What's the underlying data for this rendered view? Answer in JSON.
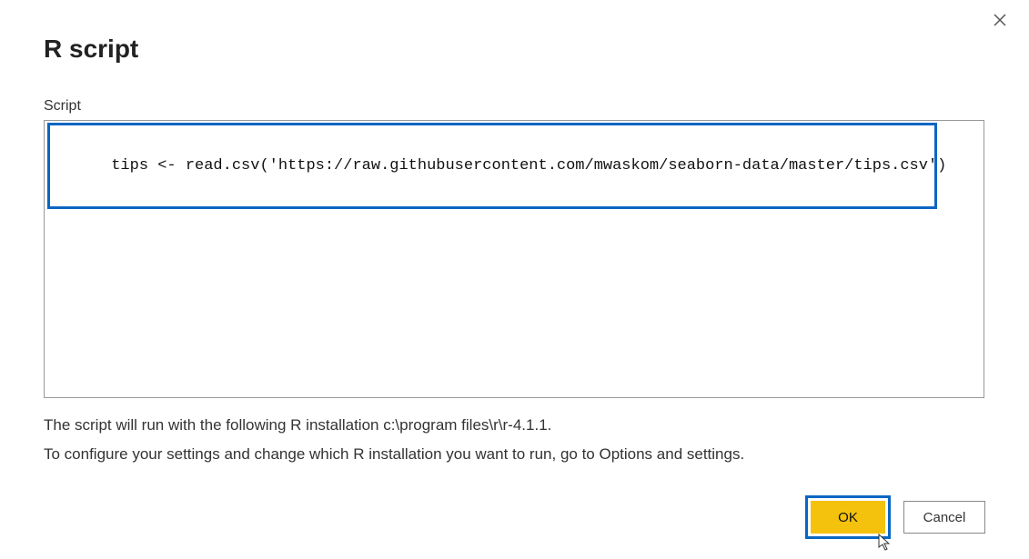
{
  "dialog": {
    "title": "R script",
    "close_icon": "close-icon"
  },
  "script": {
    "label": "Script",
    "content": "tips <- read.csv('https://raw.githubusercontent.com/mwaskom/seaborn-data/master/tips.csv')"
  },
  "info": {
    "line1": "The script will run with the following R installation c:\\program files\\r\\r-4.1.1.",
    "line2": "To configure your settings and change which R installation you want to run, go to Options and settings."
  },
  "buttons": {
    "ok_label": "OK",
    "cancel_label": "Cancel"
  },
  "highlights": {
    "script_line": true,
    "ok_button": true
  },
  "colors": {
    "highlight_border": "#0a66c2",
    "ok_bg": "#f4c20d"
  }
}
